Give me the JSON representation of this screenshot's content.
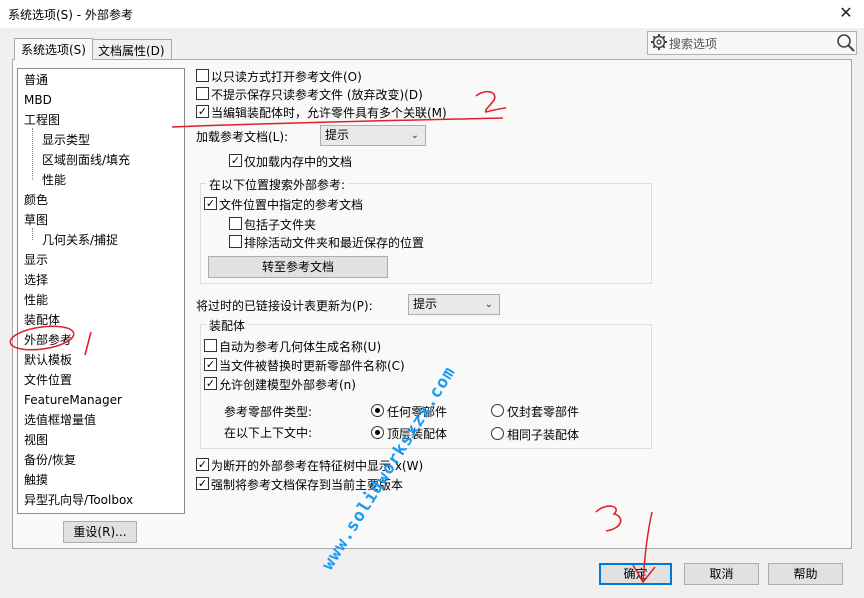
{
  "window": {
    "title": "系统选项(S) - 外部参考",
    "close_glyph": "✕"
  },
  "tabs": [
    {
      "label": "系统选项(S)",
      "active": true
    },
    {
      "label": "文档属性(D)",
      "active": false
    }
  ],
  "search": {
    "placeholder": "搜索选项"
  },
  "sidebar": {
    "items": [
      {
        "label": "普通",
        "sub": false
      },
      {
        "label": "MBD",
        "sub": false
      },
      {
        "label": "工程图",
        "sub": false
      },
      {
        "label": "显示类型",
        "sub": true
      },
      {
        "label": "区域剖面线/填充",
        "sub": true
      },
      {
        "label": "性能",
        "sub": true
      },
      {
        "label": "颜色",
        "sub": false
      },
      {
        "label": "草图",
        "sub": false
      },
      {
        "label": "几何关系/捕捉",
        "sub": true
      },
      {
        "label": "显示",
        "sub": false
      },
      {
        "label": "选择",
        "sub": false
      },
      {
        "label": "性能",
        "sub": false
      },
      {
        "label": "装配体",
        "sub": false
      },
      {
        "label": "外部参考",
        "sub": false,
        "selected": true
      },
      {
        "label": "默认模板",
        "sub": false
      },
      {
        "label": "文件位置",
        "sub": false
      },
      {
        "label": "FeatureManager",
        "sub": false
      },
      {
        "label": "选值框增量值",
        "sub": false
      },
      {
        "label": "视图",
        "sub": false
      },
      {
        "label": "备份/恢复",
        "sub": false
      },
      {
        "label": "触摸",
        "sub": false
      },
      {
        "label": "异型孔向导/Toolbox",
        "sub": false
      }
    ],
    "reset_label": "重设(R)..."
  },
  "options": {
    "open_readonly": {
      "label": "以只读方式打开参考文件(O)",
      "checked": false
    },
    "no_prompt_save": {
      "label": "不提示保存只读参考文件 (放弃改变)(D)",
      "checked": false
    },
    "allow_multi_context": {
      "label": "当编辑装配体时，允许零件具有多个关联(M)",
      "checked": true
    },
    "load_ref_docs_label": "加载参考文档(L):",
    "load_ref_docs_value": "提示",
    "load_memory_only": {
      "label": "仅加载内存中的文档",
      "checked": true
    },
    "search_group_title": "在以下位置搜索外部参考:",
    "search_file_location": {
      "label": "文件位置中指定的参考文档",
      "checked": true
    },
    "include_subfolders": {
      "label": "包括子文件夹",
      "checked": false
    },
    "exclude_active": {
      "label": "排除活动文件夹和最近保存的位置",
      "checked": false
    },
    "goto_ref_docs": "转至参考文档",
    "update_design_table_label": "将过时的已链接设计表更新为(P):",
    "update_design_table_value": "提示",
    "assembly_group_title": "装配体",
    "auto_name_geometry": {
      "label": "自动为参考几何体生成名称(U)",
      "checked": false
    },
    "update_part_names": {
      "label": "当文件被替换时更新零部件名称(C)",
      "checked": true
    },
    "allow_create_external": {
      "label": "允许创建模型外部参考(n)",
      "checked": true
    },
    "ref_part_type_label": "参考零部件类型:",
    "radio_any_part": {
      "label": "任何零部件",
      "selected": true
    },
    "radio_envelope_only": {
      "label": "仅封套零部件",
      "selected": false
    },
    "context_label": "在以下上下文中:",
    "radio_top_assembly": {
      "label": "顶层装配体",
      "selected": true
    },
    "radio_same_sub": {
      "label": "相同子装配体",
      "selected": false
    },
    "show_broken_refs": {
      "label": "为断开的外部参考在特征树中显示 x(W)",
      "checked": true
    },
    "force_save_version": {
      "label": "强制将参考文档保存到当前主要版本",
      "checked": true
    }
  },
  "footer": {
    "ok": "确定",
    "cancel": "取消",
    "help": "帮助"
  },
  "annotations": {
    "mark1": "1",
    "mark2": "2",
    "mark3": "3"
  },
  "watermark": "www.solidworksxzx.com",
  "colors": {
    "accent": "#0078d7",
    "annotation_red": "#e0202a",
    "watermark": "#1a9bf0",
    "selection_bg": "#cce8ff"
  }
}
